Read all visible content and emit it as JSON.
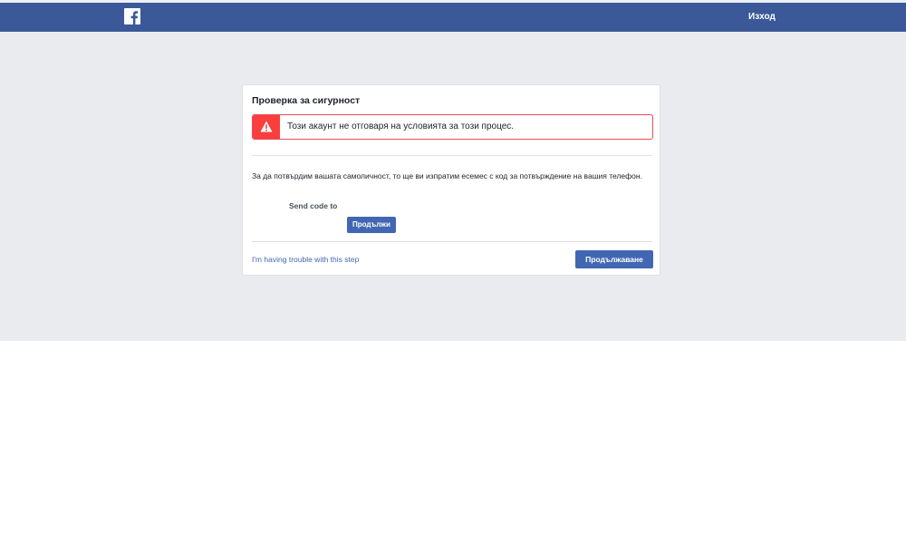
{
  "header": {
    "logo_icon": "facebook-f-icon",
    "logout_label": "Изход",
    "brand_color": "#3b5998"
  },
  "card": {
    "title": "Проверка за сигурност",
    "alert": {
      "icon": "warning-triangle-icon",
      "text": "Този акаунт не отговаря на условията за този процес.",
      "color": "#fa3e3e"
    },
    "description": "За да потвърдим вашата самоличност, то ще ви изпратим есемес с код за потвърждение на вашия телефон.",
    "send_code_label": "Send code to",
    "continue_small_label": "Продължи",
    "trouble_link": "I'm having trouble with this step",
    "continue_label": "Продължаване",
    "button_color": "#4267b2"
  }
}
